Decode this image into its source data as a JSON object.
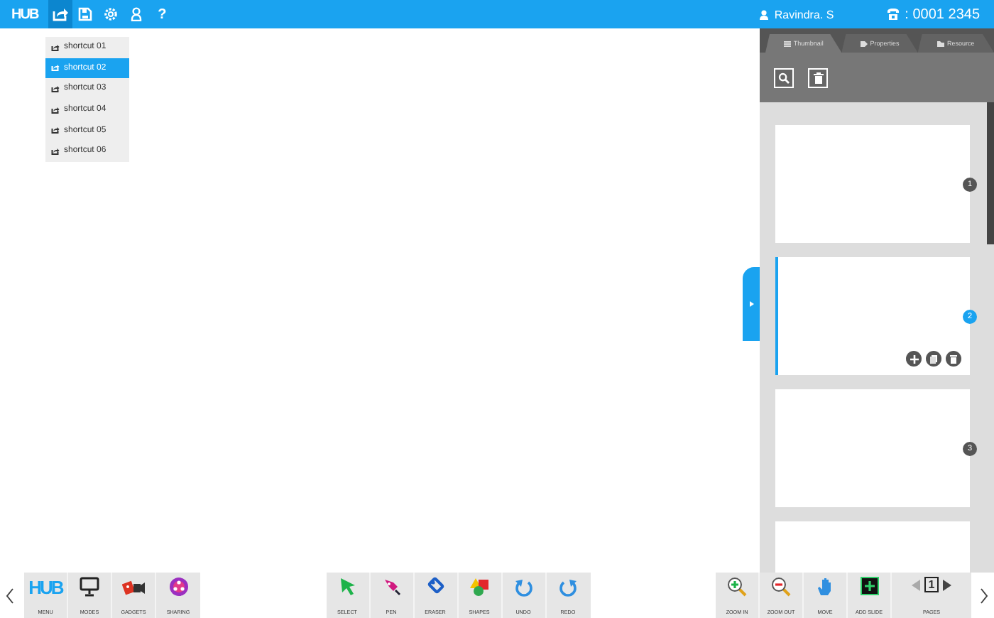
{
  "topbar": {
    "logo": "HUB",
    "tools": [
      {
        "kind": "share",
        "selected": true
      },
      {
        "kind": "save",
        "selected": false
      },
      {
        "kind": "settings",
        "selected": false
      },
      {
        "kind": "user",
        "selected": false
      },
      {
        "kind": "help",
        "text": "?",
        "selected": false
      }
    ],
    "user": "Ravindra. S",
    "id_label": ": 0001 2345"
  },
  "shortcut_menu": {
    "items": [
      {
        "label": "shortcut 01",
        "selected": false
      },
      {
        "label": "shortcut 02",
        "selected": true
      },
      {
        "label": "shortcut 03",
        "selected": false
      },
      {
        "label": "shortcut 04",
        "selected": false
      },
      {
        "label": "shortcut 05",
        "selected": false
      },
      {
        "label": "shortcut 06",
        "selected": false
      }
    ]
  },
  "side_panel": {
    "tabs": [
      {
        "kind": "thumbnail",
        "label": "Thumbnail",
        "selected": true
      },
      {
        "kind": "properties",
        "label": "Properties",
        "selected": false
      },
      {
        "kind": "resource",
        "label": "Resource",
        "selected": false
      }
    ],
    "tools": [
      {
        "kind": "search"
      },
      {
        "kind": "delete"
      }
    ],
    "slides": [
      {
        "number": "1",
        "selected": false
      },
      {
        "number": "2",
        "selected": true
      },
      {
        "number": "3",
        "selected": false
      },
      {
        "selected": false
      }
    ]
  },
  "toolbar": {
    "groups": [
      [
        {
          "kind": "menu",
          "logo": "HUB",
          "label": "MENU"
        },
        {
          "kind": "modes",
          "label": "MODES"
        },
        {
          "kind": "gadgets",
          "label": "GADGETS"
        },
        {
          "kind": "sharing",
          "label": "SHARING"
        }
      ],
      [
        {
          "kind": "select",
          "label": "SELECT"
        },
        {
          "kind": "pen",
          "label": "PEN"
        },
        {
          "kind": "eraser",
          "label": "ERASER"
        },
        {
          "kind": "shapes",
          "label": "SHAPES"
        },
        {
          "kind": "undo",
          "label": "UNDO"
        },
        {
          "kind": "redo",
          "label": "REDO"
        }
      ],
      [
        {
          "kind": "zoom_in",
          "label": "ZOOM IN"
        },
        {
          "kind": "zoom_out",
          "label": "ZOOM OUT"
        },
        {
          "kind": "move",
          "label": "MOVE"
        },
        {
          "kind": "add_slide",
          "label": "ADD SLIDE"
        },
        {
          "kind": "pages",
          "label": "PAGES",
          "page": "1"
        }
      ]
    ]
  }
}
